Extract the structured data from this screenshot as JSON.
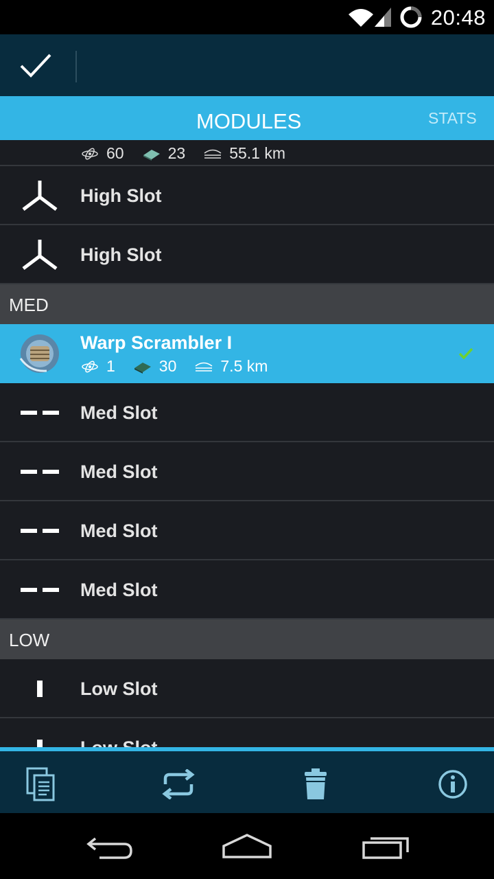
{
  "status_bar": {
    "time": "20:48",
    "icons": [
      "wifi-icon",
      "cell-signal-icon",
      "battery-ring-icon"
    ]
  },
  "action_bar": {
    "done_icon": "checkmark-icon"
  },
  "tabs": [
    {
      "label": "MODULES",
      "selected": true
    },
    {
      "label": "STATS",
      "selected": false
    }
  ],
  "list": {
    "partial_top": {
      "stats": [
        {
          "icon": "cpu-atom-icon",
          "value": "60"
        },
        {
          "icon": "powergrid-chip-icon",
          "value": "23"
        },
        {
          "icon": "range-icon",
          "value": "55.1 km"
        }
      ]
    },
    "high_slots": [
      {
        "label": "High Slot"
      },
      {
        "label": "High Slot"
      }
    ],
    "med_header": "MED",
    "selected_module": {
      "name": "Warp Scrambler I",
      "stats": [
        {
          "icon": "cpu-atom-icon",
          "value": "1"
        },
        {
          "icon": "powergrid-chip-icon",
          "value": "30"
        },
        {
          "icon": "range-icon",
          "value": "7.5 km"
        }
      ],
      "checked": true
    },
    "med_slots": [
      {
        "label": "Med Slot"
      },
      {
        "label": "Med Slot"
      },
      {
        "label": "Med Slot"
      },
      {
        "label": "Med Slot"
      }
    ],
    "low_header": "LOW",
    "low_slots": [
      {
        "label": "Low Slot"
      },
      {
        "label": "Low Slot"
      }
    ]
  },
  "toolbar": {
    "buttons": [
      "copy-document-icon",
      "swap-icon",
      "trash-icon",
      "info-icon"
    ]
  },
  "nav_bar": {
    "buttons": [
      "back-icon",
      "home-icon",
      "recents-icon"
    ]
  },
  "colors": {
    "accent": "#33b5e5",
    "action_bar": "#082c3e",
    "list_bg": "#1a1c21",
    "section_header": "#404246"
  }
}
